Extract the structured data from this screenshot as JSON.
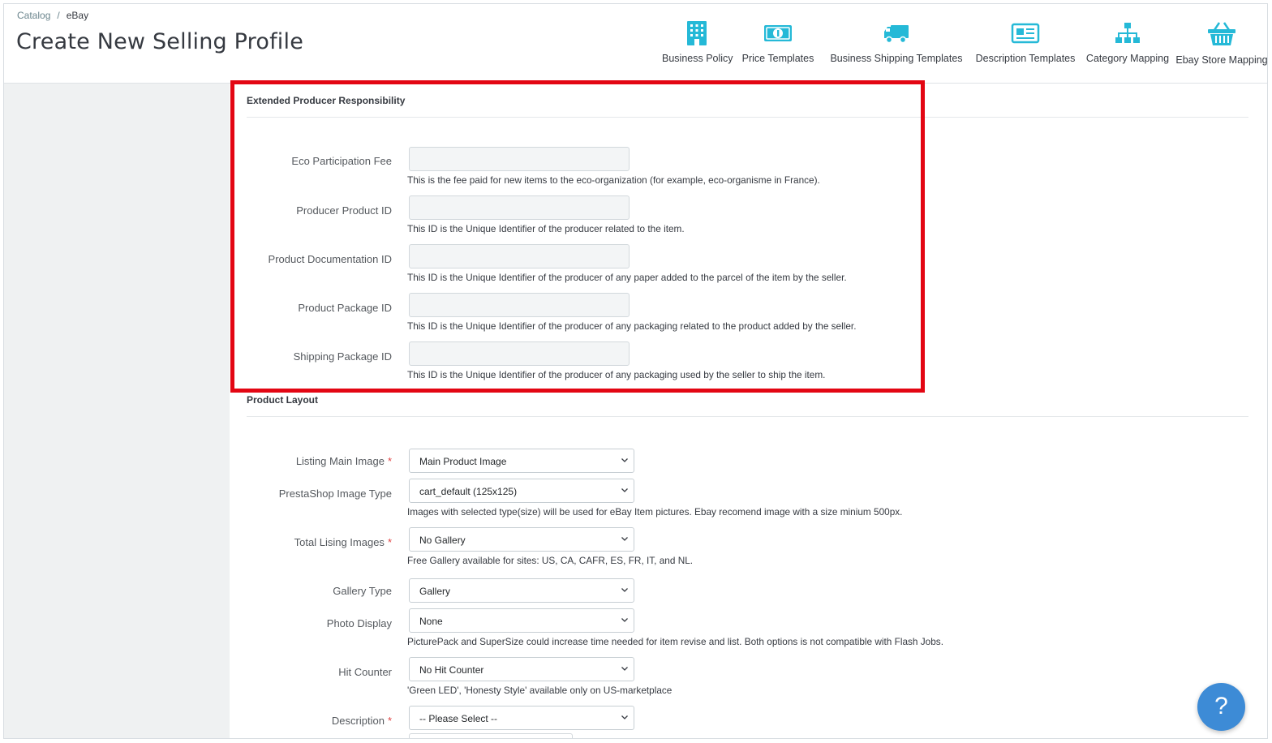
{
  "breadcrumb": {
    "parent": "Catalog",
    "separator": "/",
    "current": "eBay"
  },
  "page_title": "Create New Selling Profile",
  "toolbar": {
    "items": [
      {
        "label": "Business Policy",
        "icon": "building-icon"
      },
      {
        "label": "Price Templates",
        "icon": "banknote-icon"
      },
      {
        "label": "Business Shipping Templates",
        "icon": "truck-icon"
      },
      {
        "label": "Description Templates",
        "icon": "newspaper-icon"
      },
      {
        "label": "Category Mapping",
        "icon": "sitemap-icon"
      },
      {
        "label": "Ebay Store Mapping",
        "icon": "basket-icon"
      }
    ],
    "icon_color": "#25b9d7"
  },
  "epr": {
    "title": "Extended Producer Responsibility",
    "fields": [
      {
        "label": "Eco Participation Fee",
        "value": "",
        "help": "This is the fee paid for new items to the eco-organization (for example, eco-organisme in France)."
      },
      {
        "label": "Producer Product ID",
        "value": "",
        "help": "This ID is the Unique Identifier of the producer related to the item."
      },
      {
        "label": "Product Documentation ID",
        "value": "",
        "help": "This ID is the Unique Identifier of the producer of any paper added to the parcel of the item by the seller."
      },
      {
        "label": "Product Package ID",
        "value": "",
        "help": "This ID is the Unique Identifier of the producer of any packaging related to the product added by the seller."
      },
      {
        "label": "Shipping Package ID",
        "value": "",
        "help": "This ID is the Unique Identifier of the producer of any packaging used by the seller to ship the item."
      }
    ]
  },
  "layout": {
    "title": "Product Layout",
    "fields": [
      {
        "label": "Listing Main Image",
        "required": "*",
        "value": "Main Product Image",
        "help": ""
      },
      {
        "label": "PrestaShop Image Type",
        "required": "",
        "value": "cart_default (125x125)",
        "help": "Images with selected type(size) will be used for eBay Item pictures. Ebay recomend image with a size minium 500px."
      },
      {
        "label": "Total Lising Images",
        "required": "*",
        "value": "No Gallery",
        "help": "Free Gallery available for sites: US, CA, CAFR, ES, FR, IT, and NL."
      },
      {
        "label": "Gallery Type",
        "required": "",
        "value": "Gallery",
        "help": ""
      },
      {
        "label": "Photo Display",
        "required": "",
        "value": "None",
        "help": "PicturePack and SuperSize could increase time needed for item revise and list. Both options is not compatible with Flash Jobs."
      },
      {
        "label": "Hit Counter",
        "required": "",
        "value": "No Hit Counter",
        "help": "'Green LED', 'Honesty Style' available only on US-marketplace"
      },
      {
        "label": "Description",
        "required": "*",
        "value": "-- Please Select --",
        "help": ""
      }
    ]
  },
  "help_button": {
    "label": "?"
  },
  "colors": {
    "highlight": "#e30613",
    "fab": "#3d8bd6",
    "required": "#e04444"
  }
}
